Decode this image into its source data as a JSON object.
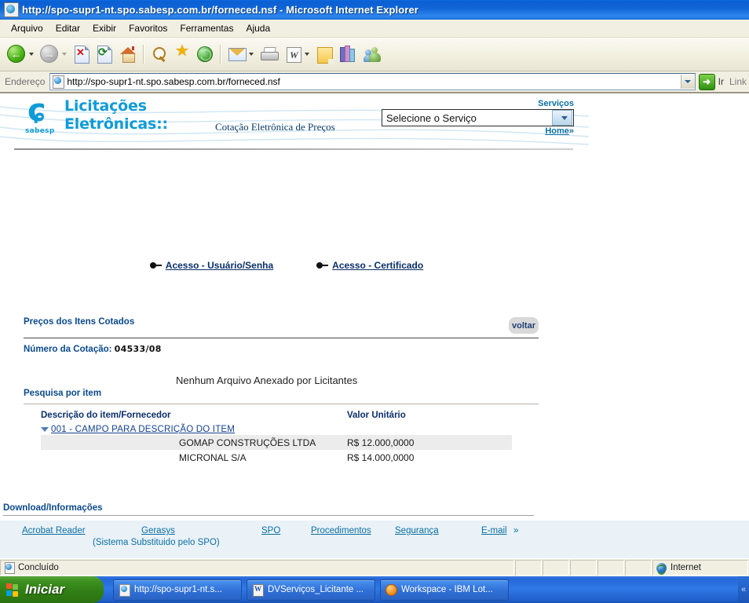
{
  "window": {
    "title": "http://spo-supr1-nt.spo.sabesp.com.br/forneced.nsf - Microsoft Internet Explorer",
    "icon": "ie-document-icon"
  },
  "menu": {
    "items": [
      "Arquivo",
      "Editar",
      "Exibir",
      "Favoritos",
      "Ferramentas",
      "Ajuda"
    ]
  },
  "toolbar": {
    "buttons": [
      {
        "name": "back-button",
        "icon": "back-arrow-icon"
      },
      {
        "name": "forward-button",
        "icon": "forward-arrow-icon"
      },
      {
        "name": "stop-button",
        "icon": "stop-x-icon"
      },
      {
        "name": "refresh-button",
        "icon": "refresh-icon"
      },
      {
        "name": "home-button",
        "icon": "home-icon"
      },
      {
        "name": "search-button",
        "icon": "search-magnifier-icon"
      },
      {
        "name": "favorites-button",
        "icon": "star-icon"
      },
      {
        "name": "history-button",
        "icon": "history-globe-icon"
      },
      {
        "name": "mail-button",
        "icon": "mail-icon"
      },
      {
        "name": "print-button",
        "icon": "printer-icon"
      },
      {
        "name": "edit-word-button",
        "icon": "word-icon"
      },
      {
        "name": "notes-button",
        "icon": "note-icon"
      },
      {
        "name": "encarta-button",
        "icon": "books-icon"
      },
      {
        "name": "messenger-button",
        "icon": "people-icon"
      }
    ]
  },
  "address": {
    "label": "Endereço",
    "url": "http://spo-supr1-nt.spo.sabesp.com.br/forneced.nsf",
    "go_label": "Ir",
    "links_label": "Link"
  },
  "site": {
    "brand_line1": "Licitações",
    "brand_line2": "Eletrônicas::",
    "brand_mark": "sabesp",
    "subtitle": "Cotação Eletrônica de Preços",
    "services_label": "Serviços",
    "services_selected": "Selecione o Serviço",
    "home_label": "Home",
    "home_suffix": "»"
  },
  "access": {
    "user_password": "Acesso - Usuário/Senha",
    "certificate": "Acesso - Certificado"
  },
  "main": {
    "section_title": "Preços dos Itens Cotados",
    "back_button": "voltar",
    "quote_label": "Número da Cotação:",
    "quote_number": "04533/08",
    "no_attachments": "Nenhum Arquivo Anexado por Licitantes",
    "search_by_item": "Pesquisa por item"
  },
  "table": {
    "headers": [
      "Descrição do item/Fornecedor",
      "Valor Unitário"
    ],
    "item_link": "001 - CAMPO PARA DESCRIÇÃO DO ITEM",
    "rows": [
      {
        "supplier": "GOMAP CONSTRUÇÕES LTDA",
        "unit_value": "R$ 12.000,0000"
      },
      {
        "supplier": "MICRONAL S/A",
        "unit_value": "R$ 14.000,0000"
      }
    ]
  },
  "footer": {
    "title": "Download/Informações",
    "links": [
      {
        "label": "Acrobat Reader"
      },
      {
        "label": "Gerasys"
      },
      {
        "label": "SPO"
      },
      {
        "label": "Procedimentos"
      },
      {
        "label": "Segurança"
      },
      {
        "label": "E-mail"
      }
    ],
    "email_suffix": "»",
    "note": "(Sistema Substituido pelo SPO)"
  },
  "statusbar": {
    "text": "Concluído",
    "zone": "Internet"
  },
  "taskbar": {
    "start": "Iniciar",
    "tasks": [
      {
        "label": "http://spo-supr1-nt.s...",
        "icon": "ie-icon"
      },
      {
        "label": "DVServiços_Licitante ...",
        "icon": "word-icon"
      },
      {
        "label": "Workspace - IBM Lot...",
        "icon": "lotus-icon"
      }
    ]
  },
  "colors": {
    "title_blue": "#0a5fd2",
    "brand_cyan": "#0f9bd7",
    "link_blue": "#0b6fa4",
    "heading_blue": "#0b4a8c",
    "taskbar_blue": "#2566d8",
    "start_green": "#3d911f"
  }
}
